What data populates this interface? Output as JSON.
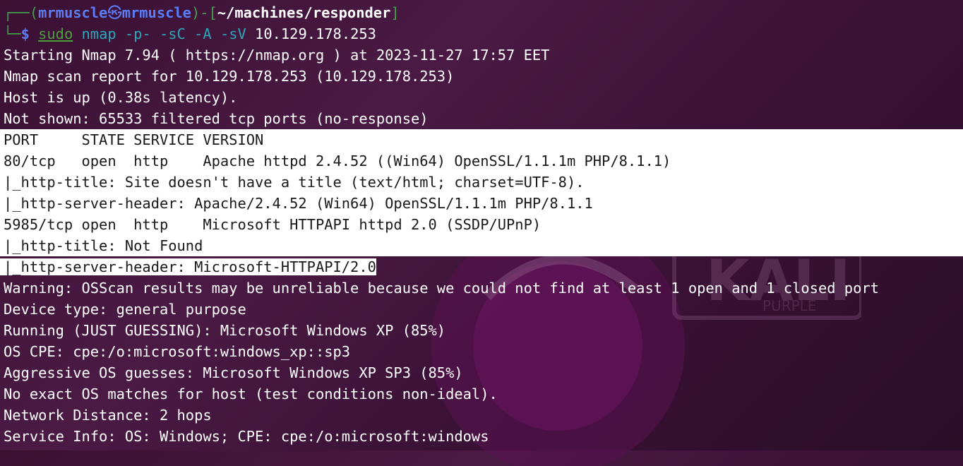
{
  "prompt": {
    "corner_top": "┌──(",
    "user": "mrmuscle",
    "skull": "㉿",
    "host": "mrmuscle",
    "sep": ")-[",
    "path": "~/machines/responder",
    "close": "]",
    "corner_bottom": "└─",
    "dollar": "$ ",
    "sudo": "sudo",
    "cmd_name": " nmap",
    "cmd_flags": " -p- -sC -A -sV",
    "cmd_target": " 10.129.178.253"
  },
  "output_before": [
    "Starting Nmap 7.94 ( https://nmap.org ) at 2023-11-27 17:57 EET",
    "Nmap scan report for 10.129.178.253 (10.129.178.253)",
    "Host is up (0.38s latency).",
    "Not shown: 65533 filtered tcp ports (no-response)"
  ],
  "selected_lines": [
    "PORT     STATE SERVICE VERSION",
    "80/tcp   open  http    Apache httpd 2.4.52 ((Win64) OpenSSL/1.1.1m PHP/8.1.1)",
    "|_http-title: Site doesn't have a title (text/html; charset=UTF-8).",
    "|_http-server-header: Apache/2.4.52 (Win64) OpenSSL/1.1.1m PHP/8.1.1",
    "5985/tcp open  http    Microsoft HTTPAPI httpd 2.0 (SSDP/UPnP)",
    "|_http-title: Not Found"
  ],
  "partial_selected_line": "|_http-server-header: Microsoft-HTTPAPI/2.0",
  "output_after": [
    "Warning: OSScan results may be unreliable because we could not find at least 1 open and 1 closed port",
    "Device type: general purpose",
    "Running (JUST GUESSING): Microsoft Windows XP (85%)",
    "OS CPE: cpe:/o:microsoft:windows_xp::sp3",
    "Aggressive OS guesses: Microsoft Windows XP SP3 (85%)",
    "No exact OS matches for host (test conditions non-ideal).",
    "Network Distance: 2 hops",
    "Service Info: OS: Windows; CPE: cpe:/o:microsoft:windows"
  ],
  "colors": {
    "background": "#3a1033",
    "prompt_frame": "#3fa24a",
    "prompt_user": "#5a7df5",
    "command": "#2aa8b8",
    "selection": "#ffffff"
  },
  "icons": {
    "background_logo": "kali-purple-logo-watermark"
  }
}
